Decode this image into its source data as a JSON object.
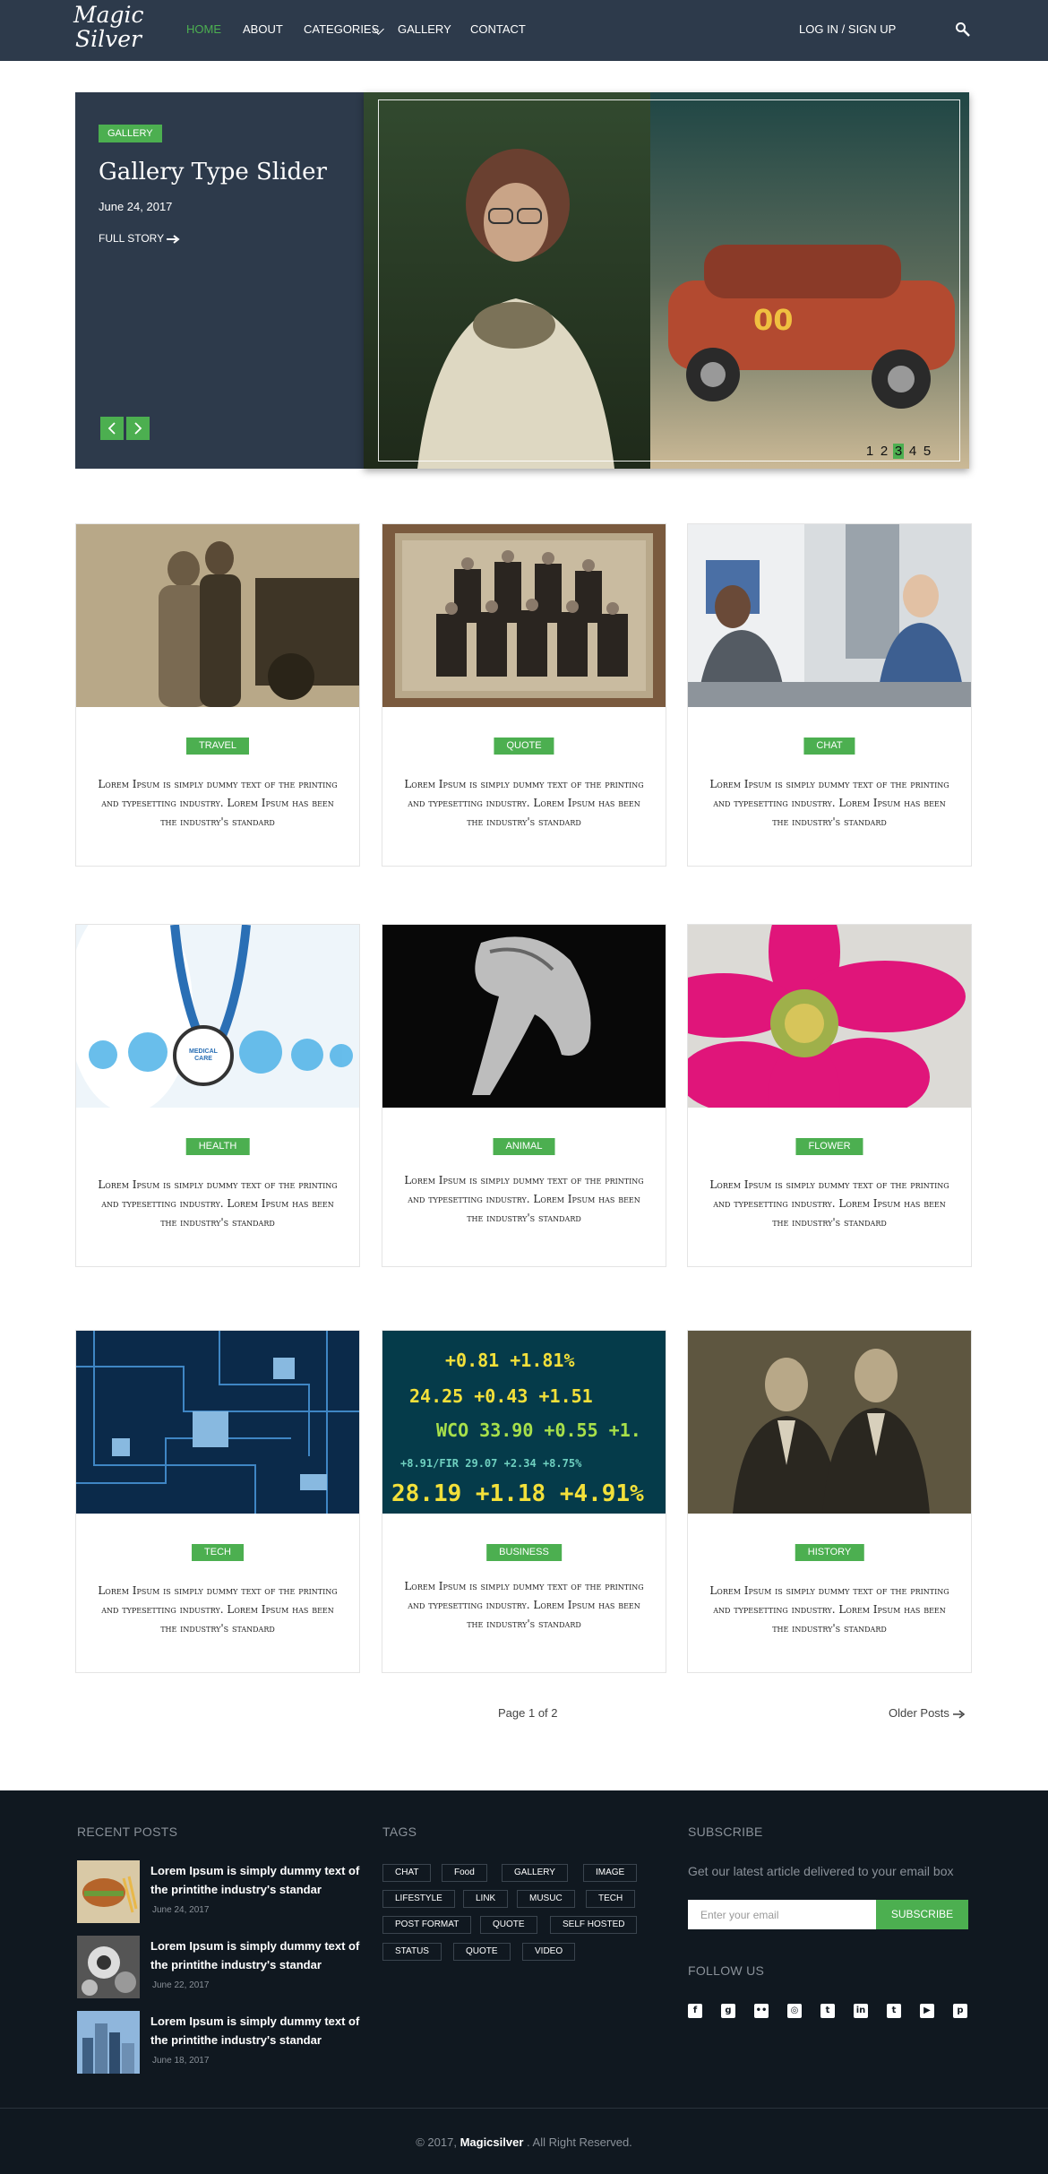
{
  "header": {
    "logo_line1": "Magic",
    "logo_line2": "Silver",
    "nav": [
      "HOME",
      "ABOUT",
      "CATEGORIES",
      "GALLERY",
      "CONTACT"
    ],
    "login": "LOG IN / SIGN UP",
    "search_icon": "search-icon"
  },
  "hero": {
    "badge": "GALLERY",
    "title": "Gallery Type Slider",
    "date": "June 24, 2017",
    "more": "FULL STORY",
    "dots": [
      "1",
      "2",
      "3",
      "4",
      "5"
    ],
    "current_dot": "3"
  },
  "posts": [
    {
      "tag": "TRAVEL",
      "excerpt": "Lorem Ipsum is simply dummy text of the printing and typesetting industry. Lorem Ipsum has been the industry's standard"
    },
    {
      "tag": "QUOTE",
      "excerpt": "Lorem Ipsum is simply dummy text of the printing and typesetting industry. Lorem Ipsum has been the industry's standard"
    },
    {
      "tag": "CHAT",
      "excerpt": "Lorem Ipsum is simply dummy text of the printing and typesetting industry. Lorem Ipsum has been the industry's standard"
    },
    {
      "tag": "HEALTH",
      "excerpt": "Lorem Ipsum is simply dummy text of the printing and typesetting industry. Lorem Ipsum has been the industry's standard"
    },
    {
      "tag": "ANIMAL",
      "excerpt": "Lorem Ipsum is simply dummy text of the printing and typesetting industry. Lorem Ipsum has been the industry's standard"
    },
    {
      "tag": "FLOWER",
      "excerpt": "Lorem Ipsum is simply dummy text of the printing and typesetting industry. Lorem Ipsum has been the industry's standard"
    },
    {
      "tag": "TECH",
      "excerpt": "Lorem Ipsum is simply dummy text of the printing and typesetting industry. Lorem Ipsum has been the industry's standard"
    },
    {
      "tag": "BUSINESS",
      "excerpt": "Lorem Ipsum is simply dummy text of the printing and typesetting industry. Lorem Ipsum has been the industry's standard"
    },
    {
      "tag": "HISTORY",
      "excerpt": "Lorem Ipsum is simply dummy text of the printing and typesetting industry. Lorem Ipsum has been the industry's standard"
    }
  ],
  "health_badge": "MEDICAL CARE",
  "pagination": {
    "info": "Page 1 of 2",
    "older": "Older Posts"
  },
  "footer": {
    "recent_heading": "RECENT POSTS",
    "recent": [
      {
        "title": "Lorem Ipsum is simply dummy text of the printithe industry's standar",
        "date": "June 24, 2017"
      },
      {
        "title": "Lorem Ipsum is simply dummy text of the printithe industry's standar",
        "date": "June 22, 2017"
      },
      {
        "title": "Lorem Ipsum is simply dummy text of the printithe industry's standar",
        "date": "June 18, 2017"
      }
    ],
    "tags_heading": "TAGS",
    "tags": [
      "CHAT",
      "Food",
      "GALLERY",
      "IMAGE",
      "LIFESTYLE",
      "LINK",
      "MUSUC",
      "TECH",
      "POST FORMAT",
      "QUOTE",
      "SELF HOSTED",
      "STATUS",
      "QUOTE",
      "VIDEO"
    ],
    "subscribe_heading": "SUBSCRIBE",
    "subscribe_text": "Get our latest article delivered to your email box",
    "email_placeholder": "Enter your email",
    "subscribe_button": "SUBSCRIBE",
    "follow_heading": "FOLLOW US",
    "social_icons": [
      "facebook-icon",
      "google-plus-icon",
      "flickr-icon",
      "instagram-icon",
      "twitter-icon",
      "linkedin-icon",
      "tumblr-icon",
      "youtube-icon",
      "pinterest-icon"
    ],
    "copyright_prefix": "© 2017,",
    "copyright_brand": "Magicsilver",
    "copyright_suffix": ". All Right Reserved."
  },
  "colors": {
    "accent": "#4caf50",
    "header_bg": "#2d3a4b",
    "footer_bg": "#101820"
  }
}
